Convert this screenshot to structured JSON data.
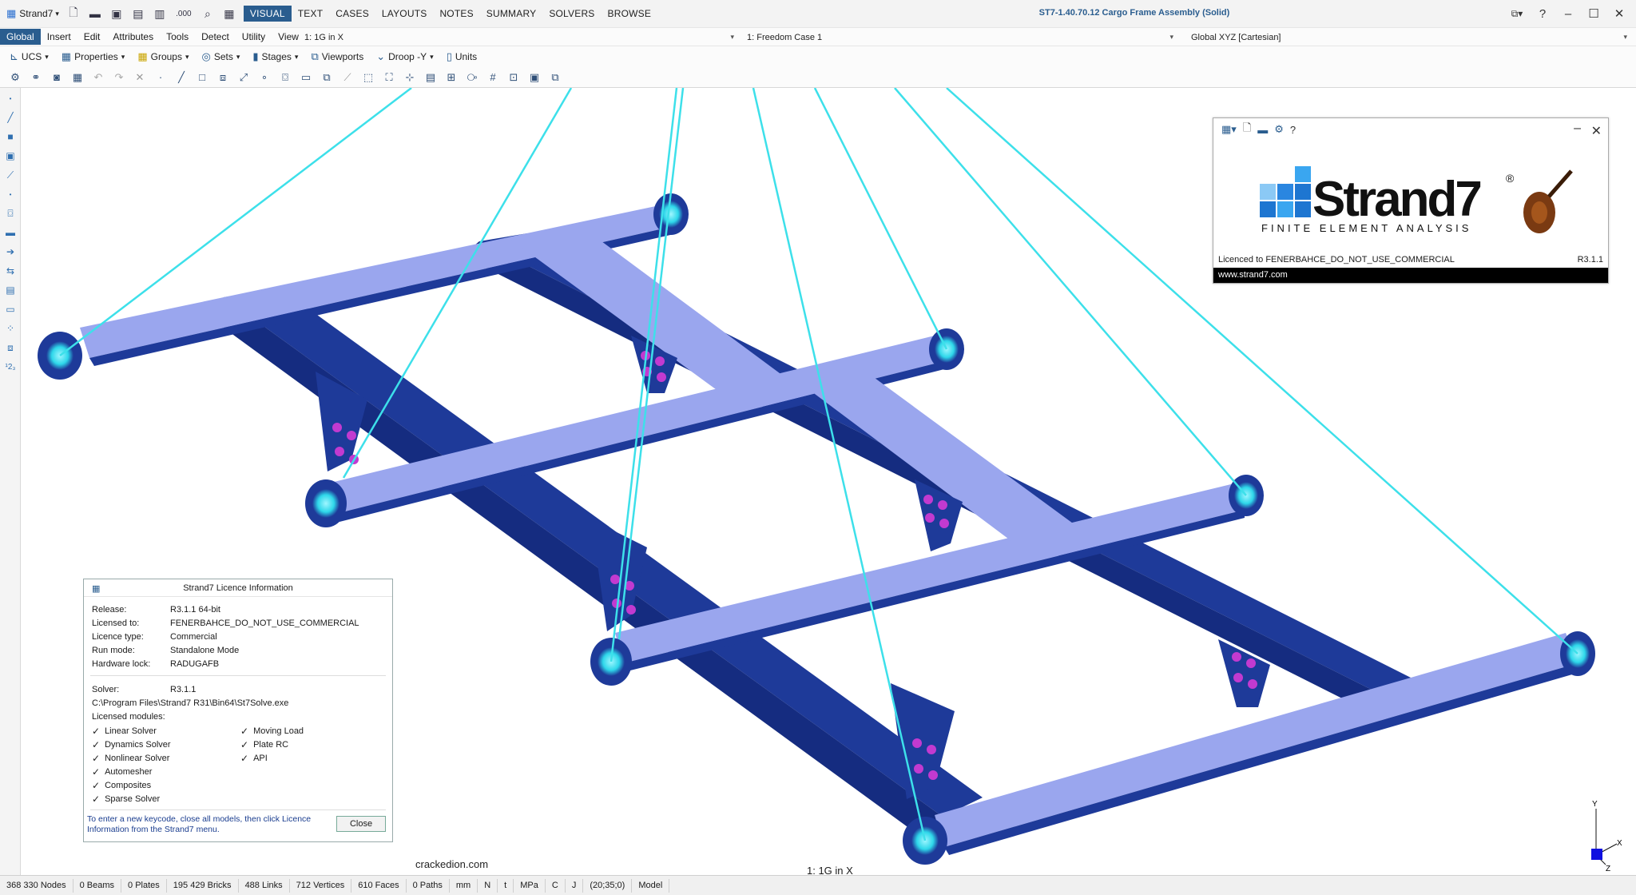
{
  "titlebar": {
    "app_menu": "Strand7",
    "quick_icons": [
      "new-file-icon",
      "open-folder-icon",
      "save-icon",
      "save-as-icon",
      "decimals-icon",
      "zoom-doc-icon",
      "calendar-icon"
    ],
    "quick_text": ".000",
    "menu_tabs": [
      "VISUAL",
      "TEXT",
      "CASES",
      "LAYOUTS",
      "NOTES",
      "SUMMARY",
      "SOLVERS",
      "BROWSE"
    ],
    "active_tab": "VISUAL",
    "window_title": "ST7-1.40.70.12 Cargo Frame Assembly (Solid)"
  },
  "submenu": {
    "items": [
      "Global",
      "Insert",
      "Edit",
      "Attributes",
      "Tools",
      "Detect",
      "Utility",
      "View"
    ],
    "active": "Global",
    "load_case": "1: 1G in X",
    "freedom_case": "1: Freedom Case 1",
    "coord_system": "Global XYZ [Cartesian]"
  },
  "toolbar1": {
    "items": [
      "UCS",
      "Properties",
      "Groups",
      "Sets",
      "Stages",
      "Viewports",
      "Droop -Y",
      "Units"
    ]
  },
  "splash": {
    "brand": "Strand7",
    "tagline": "FINITE ELEMENT ANALYSIS",
    "reg_mark": "®",
    "licence_line": "Licenced to FENERBAHCE_DO_NOT_USE_COMMERCIAL",
    "version": "R3.1.1",
    "url": "www.strand7.com"
  },
  "licence": {
    "title": "Strand7 Licence Information",
    "rows": [
      {
        "label": "Release:",
        "value": "R3.1.1 64-bit"
      },
      {
        "label": "Licensed to:",
        "value": "FENERBAHCE_DO_NOT_USE_COMMERCIAL"
      },
      {
        "label": "Licence type:",
        "value": "Commercial"
      },
      {
        "label": "Run mode:",
        "value": "Standalone Mode"
      },
      {
        "label": "Hardware lock:",
        "value": "RADUGAFB"
      }
    ],
    "solver_label": "Solver:",
    "solver_value": "R3.1.1",
    "solver_path": "C:\\Program Files\\Strand7 R31\\Bin64\\St7Solve.exe",
    "modules_label": "Licensed modules:",
    "modules_left": [
      "Linear Solver",
      "Dynamics Solver",
      "Nonlinear Solver",
      "Automesher",
      "Composites",
      "Sparse Solver"
    ],
    "modules_right": [
      "Moving Load",
      "Plate RC",
      "API"
    ],
    "note": "To enter a new keycode, close all models, then click Licence Information from the Strand7 menu.",
    "close_label": "Close"
  },
  "viewport": {
    "case_label": "1: 1G in X",
    "watermark": "crackedion.com",
    "axes": {
      "y": "Y",
      "x": "X",
      "z": "Z"
    }
  },
  "status": {
    "items": [
      "368 330 Nodes",
      "0 Beams",
      "0 Plates",
      "195 429 Bricks",
      "488 Links",
      "712 Vertices",
      "610 Faces",
      "0 Paths",
      "mm",
      "N",
      "t",
      "MPa",
      "C",
      "J",
      "(20;35;0)",
      "Model"
    ]
  },
  "colors": {
    "accent": "#2a5d8f",
    "beam_dark": "#1e3a99",
    "beam_light": "#9aa6ee",
    "link_cyan": "#3de0ea",
    "bolt_magenta": "#c23ad0"
  }
}
